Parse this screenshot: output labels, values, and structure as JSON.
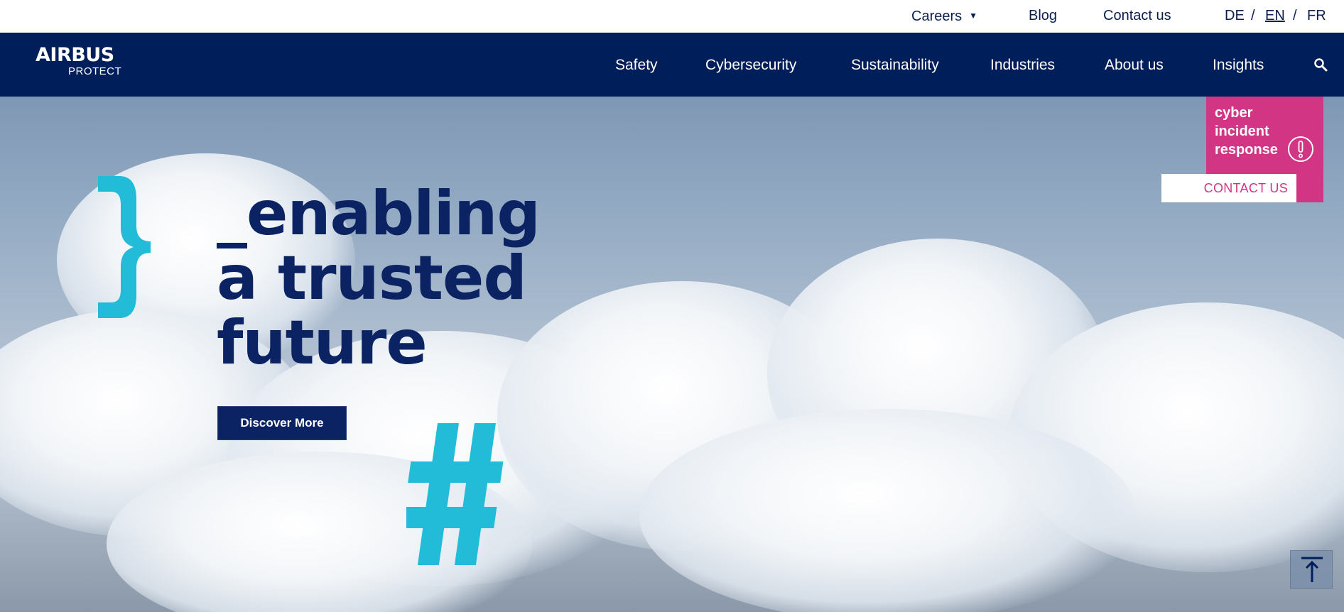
{
  "utility": {
    "careers": "Careers",
    "blog": "Blog",
    "contact": "Contact us",
    "languages": [
      "DE",
      "EN",
      "FR"
    ],
    "separator": "/",
    "active_language": "EN"
  },
  "logo": {
    "word": "AIRBUS",
    "sub": "PROTECT"
  },
  "nav": {
    "items": [
      "Safety",
      "Cybersecurity",
      "Sustainability",
      "Industries",
      "About us",
      "Insights"
    ],
    "search_icon": "search-icon"
  },
  "hero": {
    "headline": [
      "_enabling",
      "a trusted",
      "future"
    ],
    "button": "Discover More",
    "decor_brace": "}",
    "decor_hash": "#"
  },
  "incident": {
    "lines": [
      "cyber",
      "incident",
      "response"
    ],
    "icon": "exclamation-circle-icon",
    "contact": "CONTACT US"
  },
  "colors": {
    "navy": "#001e5a",
    "headline": "#0b2362",
    "cyan": "#22bbd8",
    "magenta": "#d13584"
  },
  "back_to_top_icon": "arrow-up-to-line-icon"
}
